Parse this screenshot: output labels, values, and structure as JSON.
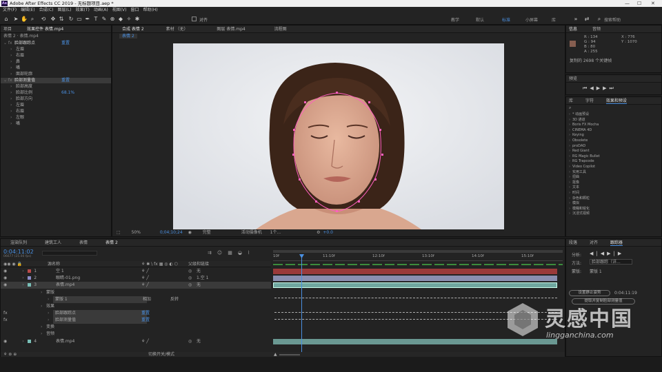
{
  "titlebar": {
    "title": "Adobe After Effects CC 2019 - 无标题项目.aep *",
    "logo": "Ae"
  },
  "menu": [
    "文件(F)",
    "编辑(E)",
    "合成(C)",
    "图层(L)",
    "效果(T)",
    "动画(A)",
    "视图(V)",
    "窗口",
    "帮助(H)"
  ],
  "toolbar": {
    "align_label": "对齐",
    "workspaces": [
      "教学",
      "默认",
      "标准",
      "小屏幕",
      "库"
    ],
    "active_workspace": "标准",
    "search_placeholder": "搜索帮助"
  },
  "project_panel": {
    "tab_project": "项目",
    "tab_effects": "效果控件 表情.mp4",
    "breadcrumb": "表情 2 · 表情.mp4",
    "rows": [
      {
        "text": "脸部跟踪点",
        "value": "重置",
        "level": 0,
        "bold": true
      },
      {
        "text": "左眉",
        "level": 1
      },
      {
        "text": "右眉",
        "level": 1
      },
      {
        "text": "鼻",
        "level": 1
      },
      {
        "text": "嘴",
        "level": 1
      },
      {
        "text": "面部轮廓",
        "level": 1
      },
      {
        "text": "脸部测量值",
        "value": "重置",
        "level": 0,
        "bold": true,
        "selected": true
      },
      {
        "text": "脸部高度",
        "level": 1
      },
      {
        "text": "脸部比例",
        "value": "68.1%",
        "level": 1
      },
      {
        "text": "脸部方向",
        "level": 1
      },
      {
        "text": "左眉",
        "level": 1
      },
      {
        "text": "右眉",
        "level": 1
      },
      {
        "text": "左眼",
        "level": 1
      },
      {
        "text": "嘴",
        "level": 1
      }
    ]
  },
  "comp_panel": {
    "tab_comp": "合成 表情 2",
    "tab_footage": "素材 （无）",
    "tab_layer": "图层 表情.mp4",
    "tab_flow": "流程图",
    "subtab": "表情 2",
    "zoom": "50%",
    "timecode": "0;04;10;24",
    "quality": "完整",
    "camera": "活动摄像机",
    "views": "1个...",
    "exposure": "+0.0"
  },
  "info_panel": {
    "tab_info": "信息",
    "tab_audio": "音频",
    "r": "R : 134",
    "g": "G : 94",
    "b": "B : 80",
    "a": "A : 255",
    "x": "X : 776",
    "y": "Y : 1070",
    "status": "复制的 2698 个关键帧",
    "swatch_color": "#865e50"
  },
  "preview_panel": {
    "title": "预览"
  },
  "effects_panel": {
    "tabs": [
      "库",
      "字符",
      "效果和预设"
    ],
    "active_tab": "效果和预设",
    "search_placeholder": "",
    "items": [
      "* 动画预设",
      "3D 通道",
      "Boris FX Mocha",
      "CINEMA 4D",
      "Keying",
      "Obsolete",
      "proDAD",
      "Red Giant",
      "RG Magic Bullet",
      "RG Trapcode",
      "Video Copilot",
      "实用工具",
      "扭曲",
      "抠像",
      "文本",
      "时间",
      "杂色和颗粒",
      "模拟",
      "模糊和锐化",
      "沉浸式视频"
    ]
  },
  "tracker_panel": {
    "tabs": [
      "段落",
      "对齐",
      "跟踪器"
    ],
    "active_tab": "跟踪器",
    "analyze_label": "分析:",
    "method_label": "方法:",
    "method_value": "脸部跟踪（详...",
    "source_label": "蒙版:",
    "source_value": "蒙版 1",
    "set_start_label": "设置静止姿势",
    "set_start_time": "0:04:11:19",
    "extract_label": "提取并复制脸部测量值"
  },
  "timeline": {
    "tabs": [
      "渲染队列",
      "建筑工人",
      "表情",
      "表情 2"
    ],
    "active_tab": "表情 2",
    "timecode": "0:04:11:02",
    "fps_label": "06677 (25.00 fps)",
    "col_name": "源名称",
    "col_parent": "父级和链接",
    "ruler": [
      "10f",
      "11:10f",
      "12:10f",
      "13:10f",
      "14:10f",
      "15:10f"
    ],
    "layers": [
      {
        "num": "1",
        "name": "空 1",
        "color": "#b94a4a",
        "parent": "无"
      },
      {
        "num": "2",
        "name": "眼睛-01.png",
        "color": "#8c8cc8",
        "parent": "1.空 1"
      },
      {
        "num": "3",
        "name": "表情.mp4",
        "color": "#7ac0b8",
        "parent": "无",
        "selected": true
      }
    ],
    "sub": [
      {
        "text": "蒙版",
        "level": 1
      },
      {
        "text": "蒙版 1",
        "level": 2,
        "mode": "相加",
        "extra": "反转"
      },
      {
        "text": "效果",
        "level": 1
      },
      {
        "text": "脸部跟踪点",
        "level": 2,
        "value": "重置"
      },
      {
        "text": "脸部测量值",
        "level": 2,
        "value": "重置"
      },
      {
        "text": "变换",
        "level": 1
      },
      {
        "text": "音频",
        "level": 1
      }
    ],
    "layer4": {
      "num": "4",
      "name": "表情.mp4",
      "color": "#7ac0b8",
      "parent": "无"
    },
    "footer": "切换开关/模式"
  },
  "watermark": {
    "cn": "灵感中国",
    "en": "lingganchina.com"
  }
}
